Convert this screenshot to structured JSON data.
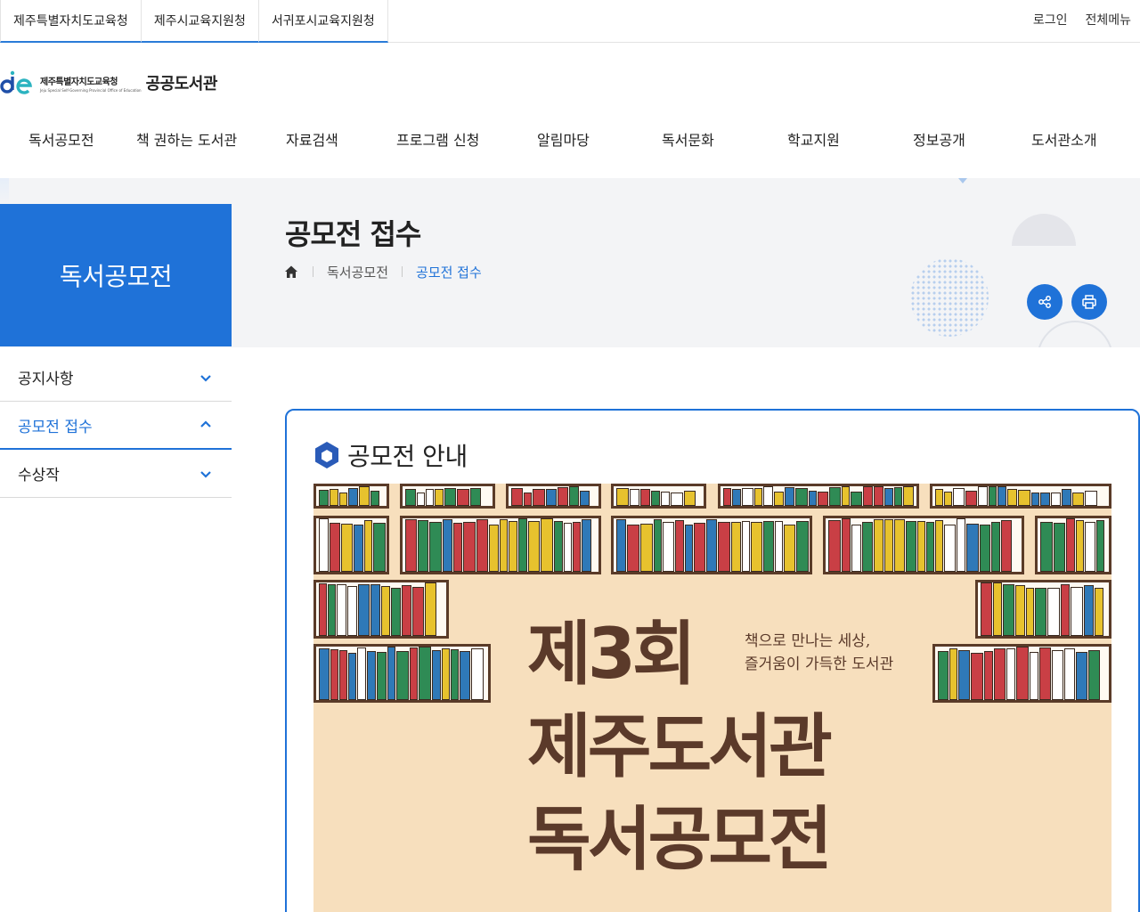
{
  "top_tabs": [
    "제주특별자치도교육청",
    "제주시교육지원청",
    "서귀포시교육지원청"
  ],
  "top_util": {
    "login": "로그인",
    "all_menu": "전체메뉴"
  },
  "logo": {
    "org": "제주특별자치도교육청",
    "eng": "Jeju Special Self-Governing Provincial Office of Education",
    "lib": "공공도서관"
  },
  "gnb": [
    "독서공모전",
    "책 권하는 도서관",
    "자료검색",
    "프로그램 신청",
    "알림마당",
    "독서문화",
    "학교지원",
    "정보공개",
    "도서관소개"
  ],
  "lnb_title": "독서공모전",
  "page_title": "공모전 접수",
  "breadcrumb": [
    "독서공모전",
    "공모전 접수"
  ],
  "side_menu": [
    {
      "label": "공지사항",
      "state": "collapsed"
    },
    {
      "label": "공모전 접수",
      "state": "expanded"
    },
    {
      "label": "수상작",
      "state": "collapsed"
    }
  ],
  "section_title": "공모전 안내",
  "poster": {
    "sub_line1": "책으로 만나는 세상,",
    "sub_line2": "즐거움이 가득한 도서관",
    "title_line1": "제3회",
    "title_line2": "제주도서관",
    "title_line3": "독서공모전"
  },
  "colors": {
    "accent": "#1f72d8",
    "poster_bg": "#f7dfbd",
    "poster_text": "#5b3a2a",
    "book_colors": [
      "#2f8b55",
      "#c93f45",
      "#e7c22e",
      "#2f79b8",
      "#ffffff"
    ]
  },
  "icons": {
    "home": "home-icon",
    "share": "share-icon",
    "print": "print-icon",
    "chevron_down": "chevron-down-icon",
    "chevron_up": "chevron-up-icon",
    "section": "hexagon-icon"
  }
}
